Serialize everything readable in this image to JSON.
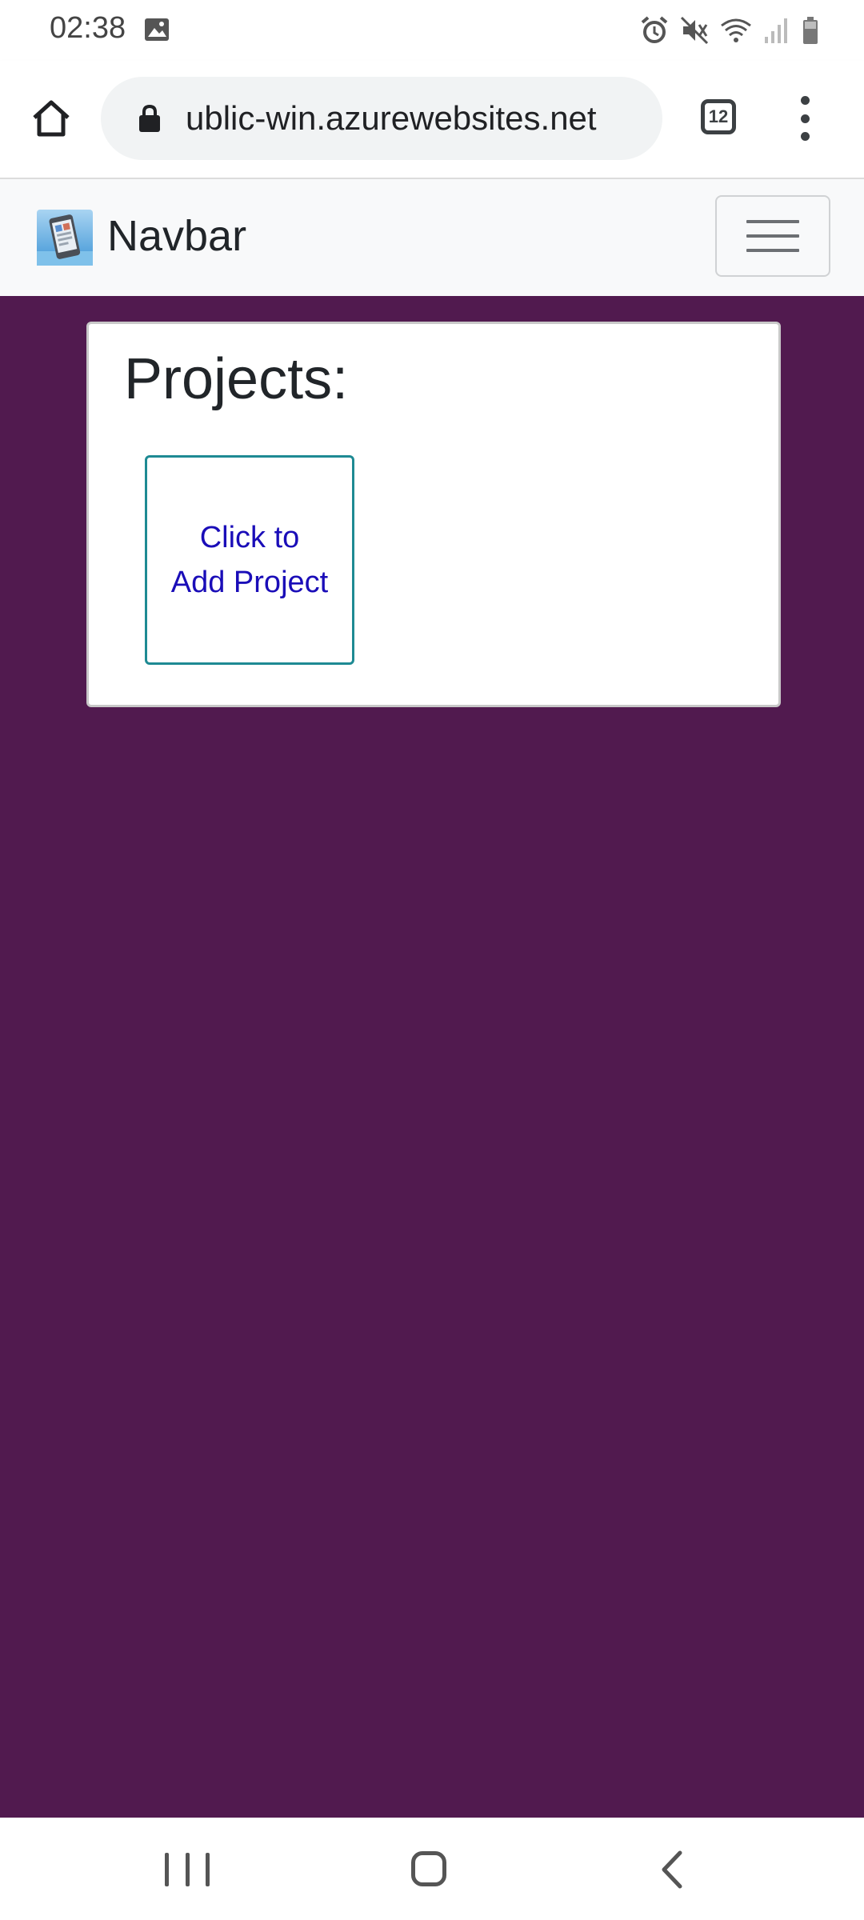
{
  "status_bar": {
    "time": "02:38",
    "left_icons": [
      "gallery-icon"
    ],
    "right_icons": [
      "alarm-icon",
      "mute-icon",
      "wifi-icon",
      "signal-icon",
      "battery-icon"
    ]
  },
  "browser": {
    "url": "ublic-win.azurewebsites.net",
    "tab_count": "12",
    "icons": [
      "home-icon",
      "lock-icon",
      "more-vert-icon"
    ]
  },
  "navbar": {
    "brand": "Navbar",
    "logo_icon": "phone-app-icon",
    "toggler_icon": "hamburger-icon"
  },
  "main": {
    "background_color": "#511a4f",
    "projects_title": "Projects:",
    "add_project_line1": "Click to",
    "add_project_line2": "Add Project",
    "add_tile_border_color": "#1e8a93",
    "add_tile_text_color": "#1a0db8"
  },
  "system_nav": {
    "icons": [
      "recents-icon",
      "home-icon",
      "back-icon"
    ]
  }
}
